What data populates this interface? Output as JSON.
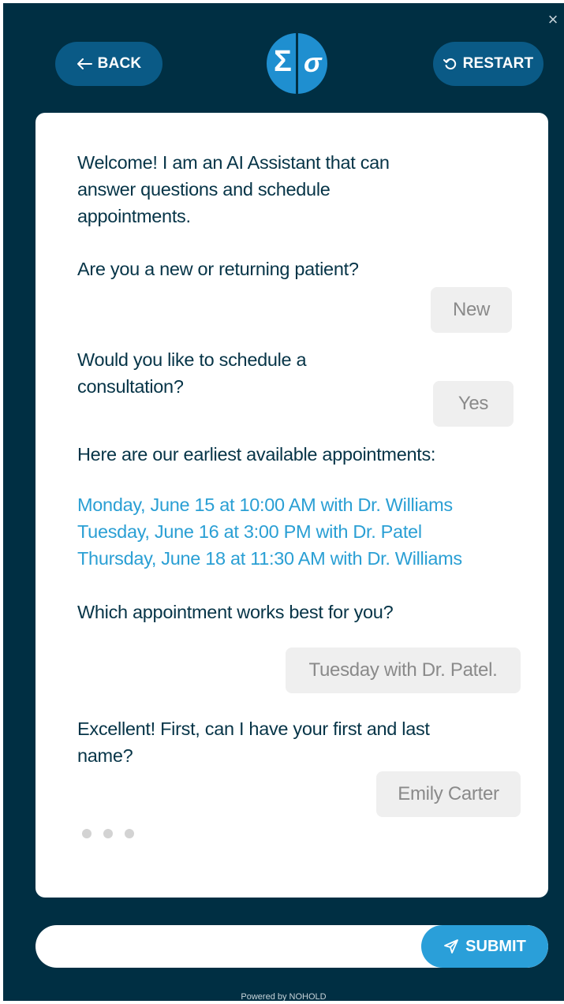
{
  "header": {
    "back_label": "BACK",
    "restart_label": "RESTART",
    "logo_left": "Σ",
    "logo_right": "σ",
    "close_glyph": "×"
  },
  "chat": {
    "welcome": [
      "Welcome! I am an AI Assistant that can",
      "answer questions and schedule",
      "appointments."
    ],
    "q_patient": "Are you a new or returning patient?",
    "a_patient": "New",
    "q_consult": [
      "Would you like to schedule a",
      "consultation?"
    ],
    "a_consult": "Yes",
    "q_appointments": "Here are our earliest available appointments:",
    "appointments": [
      "Monday, June 15 at 10:00 AM with Dr. Williams",
      "Tuesday, June 16 at 3:00 PM with Dr. Patel",
      "Thursday, June 18 at 11:30 AM with Dr. Williams"
    ],
    "q_which": "Which appointment works best for you?",
    "a_which": "Tuesday with Dr. Patel.",
    "q_name": [
      "Excellent! First, can I have your first and last",
      "name?"
    ],
    "a_name": "Emily Carter"
  },
  "input": {
    "placeholder": "",
    "submit_label": "SUBMIT"
  },
  "footer": {
    "text": "Powered by NOHOLD"
  },
  "colors": {
    "background": "#002f43",
    "button": "#0a5a86",
    "accent": "#2a9fd9",
    "link": "#2a9fd4",
    "bot_text": "#063447"
  }
}
